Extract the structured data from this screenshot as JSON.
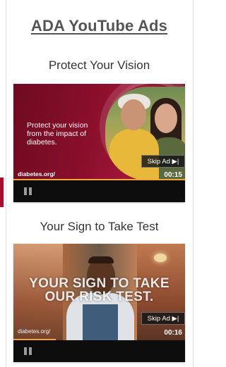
{
  "header": {
    "title": "ADA YouTube Ads"
  },
  "ads": [
    {
      "caption": "Protect Your Vision",
      "overlay_text": "Protect your vision from the impact of diabetes.",
      "url_text": "diabetes.org/",
      "skip_label": "Skip Ad ▶|",
      "duration": "00:15"
    },
    {
      "caption": "Your Sign to Take Test",
      "overlay_text": "YOUR SIGN TO TAKE OUR RISK TEST.",
      "url_text": "diabetes.org/",
      "skip_label": "Skip Ad ▶|",
      "duration": "00:16"
    }
  ],
  "colors": {
    "accent": "#a50f2d",
    "progress": "#f2a33a",
    "title": "#555555"
  },
  "icons": [
    "pause-icon",
    "skip-icon"
  ]
}
